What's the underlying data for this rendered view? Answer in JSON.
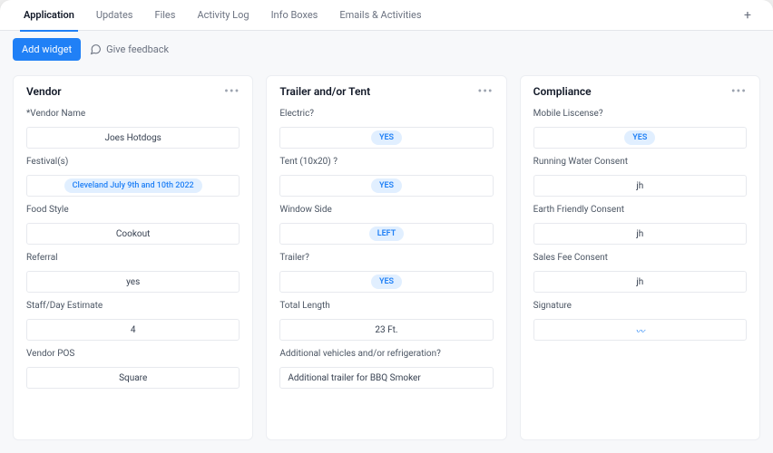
{
  "tabs": {
    "items": [
      "Application",
      "Updates",
      "Files",
      "Activity Log",
      "Info Boxes",
      "Emails & Activities"
    ],
    "active_index": 0
  },
  "toolbar": {
    "add_widget": "Add widget",
    "give_feedback": "Give feedback"
  },
  "cards": {
    "vendor": {
      "title": "Vendor",
      "fields": {
        "vendor_name": {
          "label": "*Vendor Name",
          "value": "Joes Hotdogs"
        },
        "festivals": {
          "label": "Festival(s)",
          "value": "Cleveland July 9th and 10th 2022"
        },
        "food_style": {
          "label": "Food Style",
          "value": "Cookout"
        },
        "referral": {
          "label": "Referral",
          "value": "yes"
        },
        "staff_day": {
          "label": "Staff/Day Estimate",
          "value": "4"
        },
        "vendor_pos": {
          "label": "Vendor POS",
          "value": "Square"
        }
      }
    },
    "trailer": {
      "title": "Trailer and/or Tent",
      "fields": {
        "electric": {
          "label": "Electric?",
          "value": "YES"
        },
        "tent": {
          "label": "Tent (10x20) ?",
          "value": "YES"
        },
        "window_side": {
          "label": "Window Side",
          "value": "LEFT"
        },
        "trailer": {
          "label": "Trailer?",
          "value": "YES"
        },
        "total_length": {
          "label": "Total Length",
          "value": "23 Ft."
        },
        "additional": {
          "label": "Additional vehicles and/or refrigeration?",
          "value": "Additional trailer for BBQ Smoker"
        }
      }
    },
    "compliance": {
      "title": "Compliance",
      "fields": {
        "mobile_license": {
          "label": "Mobile Liscense?",
          "value": "YES"
        },
        "running_water": {
          "label": "Running Water Consent",
          "value": "jh"
        },
        "earth_friendly": {
          "label": "Earth Friendly Consent",
          "value": "jh"
        },
        "sales_fee": {
          "label": "Sales Fee Consent",
          "value": "jh"
        },
        "signature": {
          "label": "Signature",
          "value": "~"
        }
      }
    }
  }
}
